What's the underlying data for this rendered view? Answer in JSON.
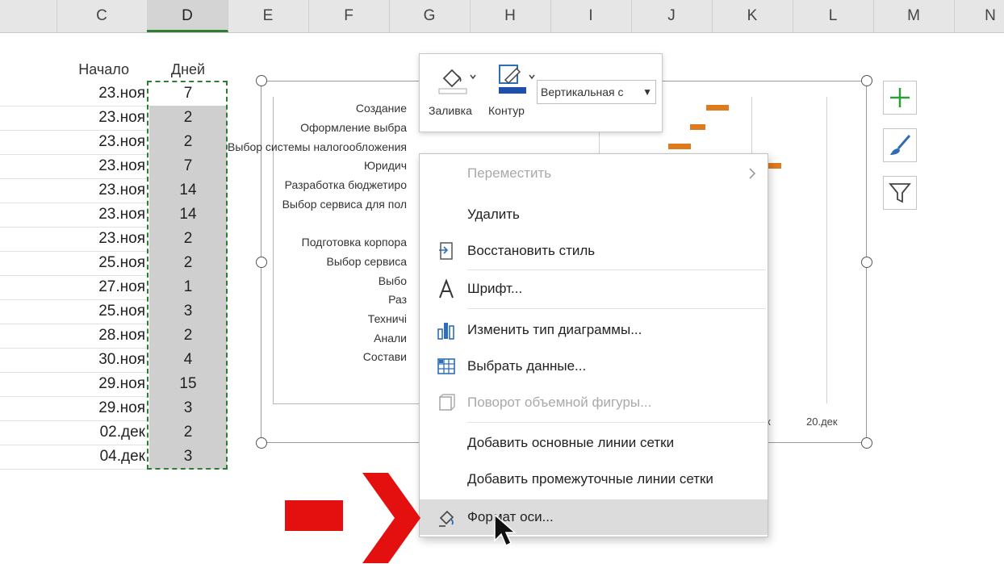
{
  "columns": [
    "C",
    "D",
    "E",
    "F",
    "G",
    "H",
    "I",
    "J",
    "K",
    "L",
    "M",
    "N"
  ],
  "sheet": {
    "header_start": "Начало",
    "header_days": "Дней",
    "rows": [
      {
        "date": "23.ноя",
        "days": "7"
      },
      {
        "date": "23.ноя",
        "days": "2"
      },
      {
        "date": "23.ноя",
        "days": "2"
      },
      {
        "date": "23.ноя",
        "days": "7"
      },
      {
        "date": "23.ноя",
        "days": "14"
      },
      {
        "date": "23.ноя",
        "days": "14"
      },
      {
        "date": "23.ноя",
        "days": "2"
      },
      {
        "date": "25.ноя",
        "days": "2"
      },
      {
        "date": "27.ноя",
        "days": "1"
      },
      {
        "date": "25.ноя",
        "days": "3"
      },
      {
        "date": "28.ноя",
        "days": "2"
      },
      {
        "date": "30.ноя",
        "days": "4"
      },
      {
        "date": "29.ноя",
        "days": "15"
      },
      {
        "date": "29.ноя",
        "days": "3"
      },
      {
        "date": "02.дек",
        "days": "2"
      },
      {
        "date": "04.дек",
        "days": "3"
      }
    ]
  },
  "chart": {
    "task_labels": [
      "Создание",
      "Оформление выбра",
      "Выбор системы налогообложения",
      "Юридич",
      "Разработка бюджетиро",
      "Выбор сервиса для пол",
      "Подготовка корпора",
      "Выбор сервиса",
      "Выбо",
      "Раз",
      "Техничі",
      "Анали",
      "Состави"
    ],
    "x_tick_partial": "к",
    "x_tick": "20.дек",
    "bar_color": "#e07a1f"
  },
  "mini_toolbar": {
    "fill_label": "Заливка",
    "outline_label": "Контур",
    "select_value": "Вертикальная с"
  },
  "context_menu": {
    "items": [
      {
        "label": "Переместить",
        "disabled": true,
        "icon": "move-icon",
        "submenu": true
      },
      {
        "label": "Удалить",
        "disabled": false,
        "icon": ""
      },
      {
        "label": "Восстановить стиль",
        "disabled": false,
        "icon": "reset-style-icon"
      },
      {
        "label": "Шрифт...",
        "disabled": false,
        "icon": "font-icon"
      },
      {
        "label": "Изменить тип диаграммы...",
        "disabled": false,
        "icon": "chart-type-icon"
      },
      {
        "label": "Выбрать данные...",
        "disabled": false,
        "icon": "select-data-icon"
      },
      {
        "label": "Поворот объемной фигуры...",
        "disabled": true,
        "icon": "3d-rotation-icon"
      },
      {
        "label": "Добавить основные линии сетки",
        "disabled": false,
        "icon": ""
      },
      {
        "label": "Добавить промежуточные линии сетки",
        "disabled": false,
        "icon": ""
      },
      {
        "label": "Формат оси...",
        "disabled": false,
        "icon": "format-axis-icon",
        "highlighted": true
      }
    ]
  },
  "side_buttons": [
    "chart-elements-plus-icon",
    "chart-styles-brush-icon",
    "chart-filter-icon"
  ],
  "colors": {
    "selection": "#2e7d32",
    "accent_bar": "#e07a1f",
    "arrow": "#e3100f"
  }
}
